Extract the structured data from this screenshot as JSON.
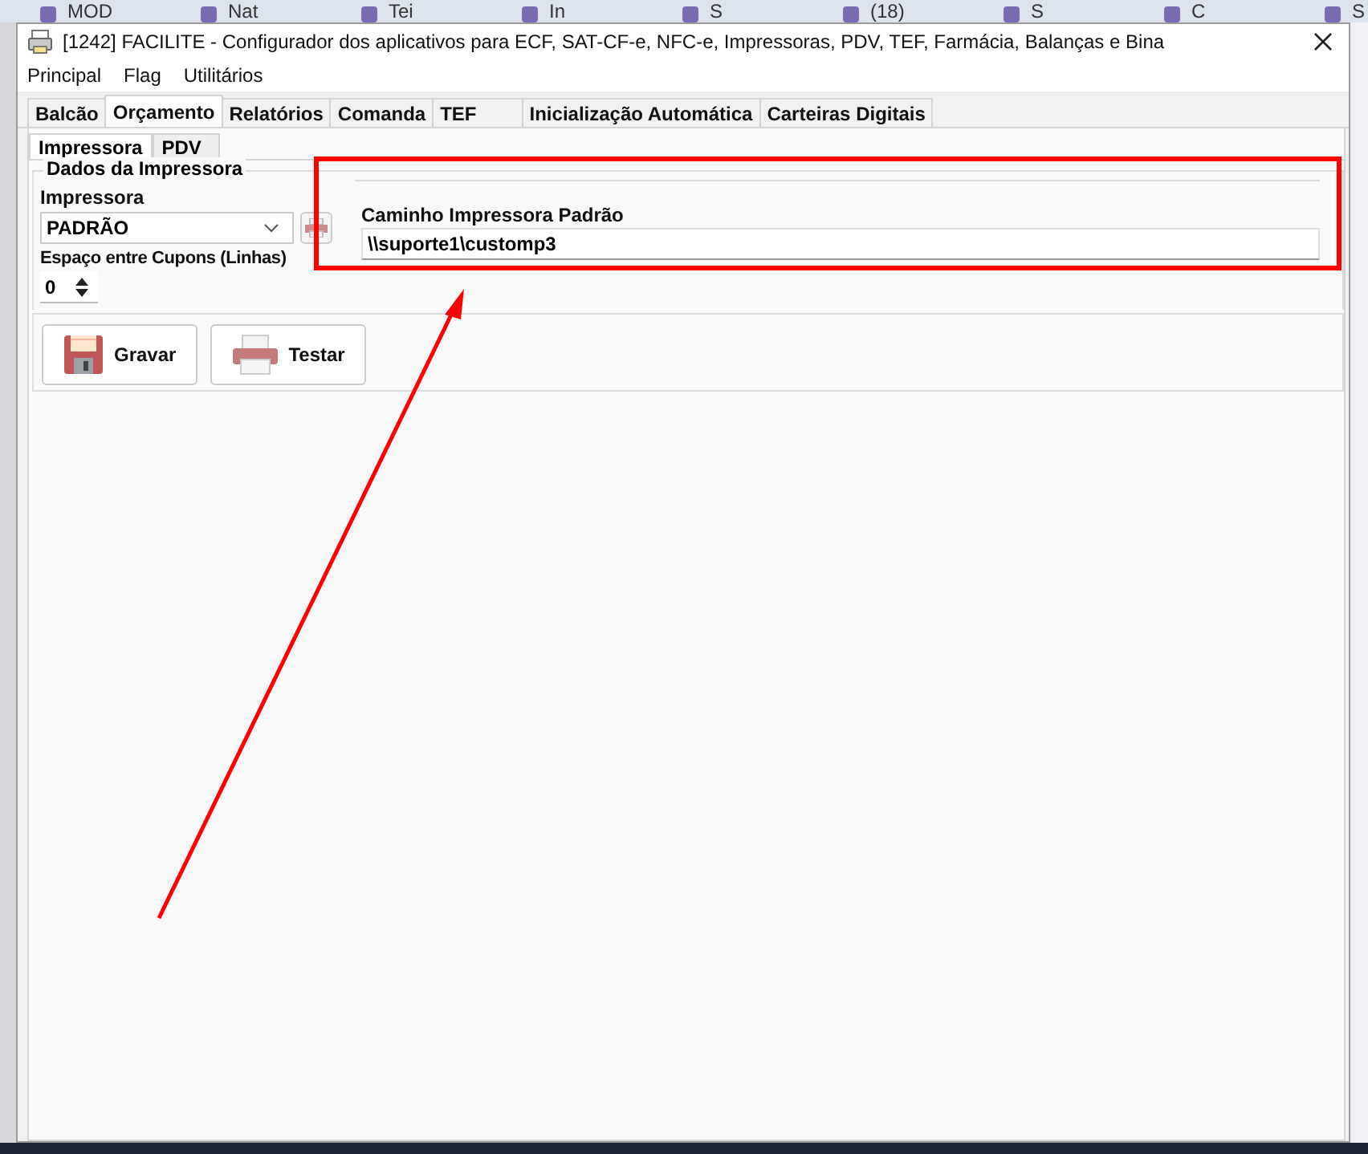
{
  "browser_tabs": [
    {
      "label": "MOD"
    },
    {
      "label": "Nat"
    },
    {
      "label": "Tei"
    },
    {
      "label": "In"
    },
    {
      "label": "S"
    },
    {
      "label": "(18)"
    },
    {
      "label": "S"
    },
    {
      "label": "C"
    },
    {
      "label": "S"
    }
  ],
  "window": {
    "title": "[1242] FACILITE - Configurador dos aplicativos para ECF, SAT-CF-e, NFC-e, Impressoras, PDV, TEF, Farmácia, Balanças e Bina"
  },
  "menu": [
    {
      "label": "Principal"
    },
    {
      "label": "Flag"
    },
    {
      "label": "Utilitários"
    }
  ],
  "tabs": [
    {
      "label": "Balcão",
      "selected": false
    },
    {
      "label": "Orçamento",
      "selected": true
    },
    {
      "label": "Relatórios",
      "selected": false
    },
    {
      "label": "Comanda",
      "selected": false
    },
    {
      "label": "TEF",
      "selected": false
    },
    {
      "label": "Inicialização Automática",
      "selected": false
    },
    {
      "label": "Carteiras Digitais",
      "selected": false
    }
  ],
  "subtabs": [
    {
      "label": "Impressora",
      "selected": true
    },
    {
      "label": "PDV",
      "selected": false
    }
  ],
  "group": {
    "title": "Dados da Impressora",
    "printer_label": "Impressora",
    "printer_value": "PADRÃO",
    "spacing_label": "Espaço entre Cupons (Linhas)",
    "spacing_value": "0",
    "path_label": "Caminho Impressora Padrão",
    "path_value": "\\\\suporte1\\customp3"
  },
  "buttons": [
    {
      "label": "Gravar",
      "kind": "save"
    },
    {
      "label": "Testar",
      "kind": "print"
    }
  ]
}
